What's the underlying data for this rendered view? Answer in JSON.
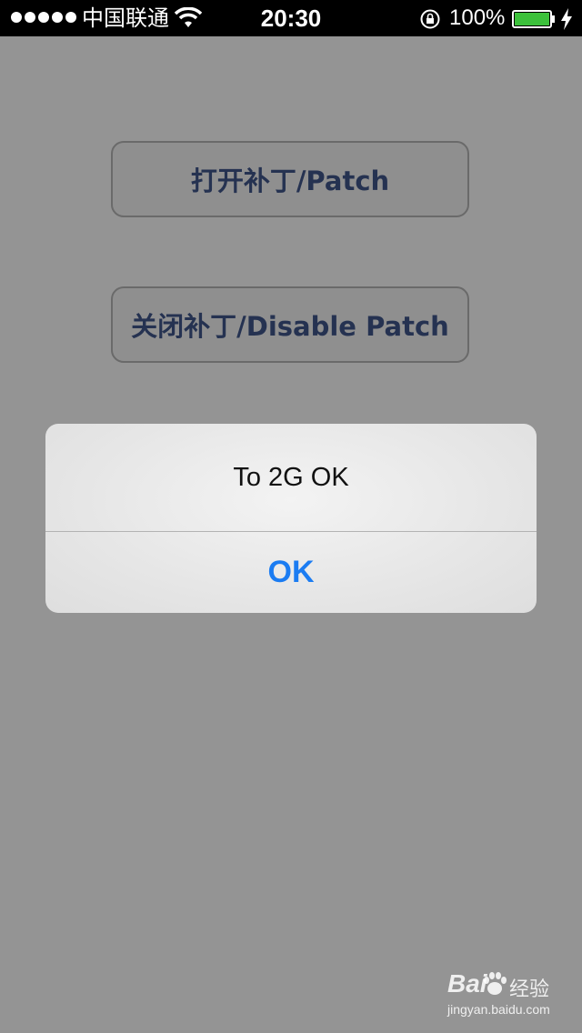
{
  "status_bar": {
    "carrier": "中国联通",
    "time": "20:30",
    "battery_percent": "100%",
    "battery_level": 1.0,
    "signal_bars": 5,
    "icons": [
      "signal-dots",
      "wifi-icon",
      "rotation-lock-icon",
      "battery-icon",
      "charging-icon"
    ]
  },
  "buttons": {
    "open_patch": "打开补丁/Patch",
    "close_patch": "关闭补丁/Disable Patch"
  },
  "alert": {
    "message": "To 2G OK",
    "ok_label": "OK"
  },
  "watermark": {
    "brand": "Bai",
    "brand_suffix": "经验",
    "url": "jingyan.baidu.com"
  },
  "colors": {
    "background": "#949494",
    "button_text": "#253251",
    "alert_button": "#1b7cf2",
    "battery": "#3cc13b"
  }
}
